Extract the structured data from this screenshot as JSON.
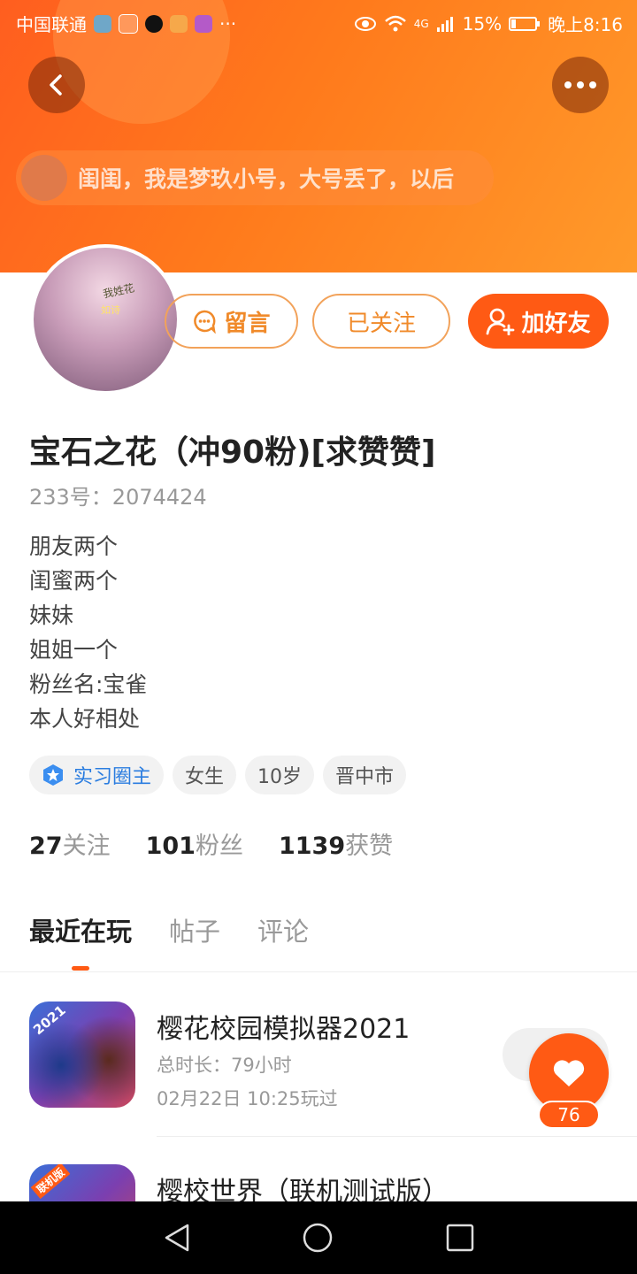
{
  "status_bar": {
    "carrier": "中国联通",
    "more": "···",
    "network": "4G",
    "battery": "15%",
    "time": "晚上8:16"
  },
  "header": {
    "ticker_text": "闺闺，我是梦玖小号，大号丢了，以后"
  },
  "avatar": {
    "overlay_text_1": "我姓花",
    "overlay_text_2": "如诗"
  },
  "actions": {
    "message_label": "留言",
    "followed_label": "已关注",
    "add_friend_label": "加好友"
  },
  "profile": {
    "name": "宝石之花（冲90粉)[求赞赞]",
    "uid": "233号：2074424",
    "bio": [
      "朋友两个",
      "闺蜜两个",
      "妹妹",
      "姐姐一个",
      "粉丝名:宝雀",
      "本人好相处"
    ],
    "tags": [
      "实习圈主",
      "女生",
      "10岁",
      "晋中市"
    ]
  },
  "stats": {
    "following_count": "27",
    "following_label": "关注",
    "fans_count": "101",
    "fans_label": "粉丝",
    "likes_count": "1139",
    "likes_label": "获赞"
  },
  "tabs": [
    "最近在玩",
    "帖子",
    "评论"
  ],
  "games": [
    {
      "icon_badge": "2021",
      "title": "樱花校园模拟器2021",
      "duration": "总时长：79小时",
      "last_played": "02月22日 10:25玩过"
    },
    {
      "icon_badge": "联机版",
      "title": "樱校世界（联机测试版）"
    }
  ],
  "floating": {
    "like_count": "76"
  },
  "colors": {
    "accent": "#ff5a14",
    "header_orange": "#ff7a1c",
    "outline_orange": "#f2a25a",
    "tag_blue": "#2b7de0"
  }
}
